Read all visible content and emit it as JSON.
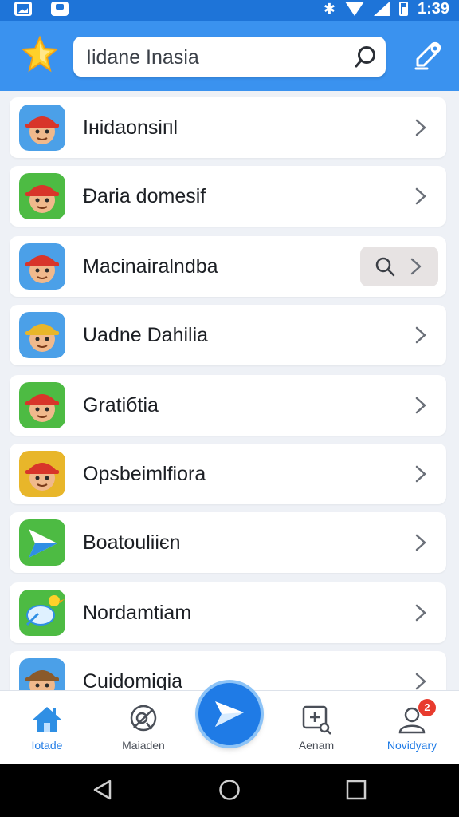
{
  "status_bar": {
    "time": "1:39",
    "bluetooth_glyph": "✱"
  },
  "search": {
    "value": "Iidane Inasia"
  },
  "list": {
    "items": [
      {
        "label": "Iнidaonsiпl",
        "icon": "red-hat-character-avatar",
        "tile": "#4ba0e8",
        "hat": "#d8352a"
      },
      {
        "label": "Ðaria domesif",
        "icon": "red-hat-glasses-avatar",
        "tile": "#4dbb43",
        "hat": "#d8352a"
      },
      {
        "label": "Macinairalndba",
        "icon": "flower-hat-girl-avatar",
        "tile": "#4ba0e8",
        "hat": "#d8352a"
      },
      {
        "label": "Uadne Dahilia",
        "icon": "crown-glasses-avatar",
        "tile": "#4ba0e8",
        "hat": "#e8b62a"
      },
      {
        "label": "Gratiбtia",
        "icon": "green-cap-avatar",
        "tile": "#4dbb43",
        "hat": "#d8352a"
      },
      {
        "label": "Opsbeimlfiora",
        "icon": "goggles-pilot-avatar",
        "tile": "#e8b62a",
        "hat": "#d8352a"
      },
      {
        "label": "Boatouliiєn",
        "icon": "paper-plane-app-icon",
        "tile": "#4dbb43",
        "hat": "#2f8fe4"
      },
      {
        "label": "Nordamtiam",
        "icon": "bird-app-icon",
        "tile": "#4dbb43",
        "hat": "#2f8fe4"
      },
      {
        "label": "Cuidomiqia",
        "icon": "brown-bear-avatar",
        "tile": "#4ba0e8",
        "hat": "#8a5a2b"
      }
    ]
  },
  "bottom_nav": {
    "items": [
      {
        "label": "Iotade",
        "icon": "home-icon",
        "active": true
      },
      {
        "label": "Maiaden",
        "icon": "search-dashboard-icon",
        "active": false
      },
      {
        "label": "Aenam",
        "icon": "add-note-icon",
        "active": false
      },
      {
        "label": "Novidyary",
        "icon": "profile-icon",
        "active": true
      }
    ],
    "badge": "2"
  },
  "colors": {
    "accent": "#1f7be6",
    "header": "#3a92ef",
    "status_bar": "#1e74d8"
  }
}
